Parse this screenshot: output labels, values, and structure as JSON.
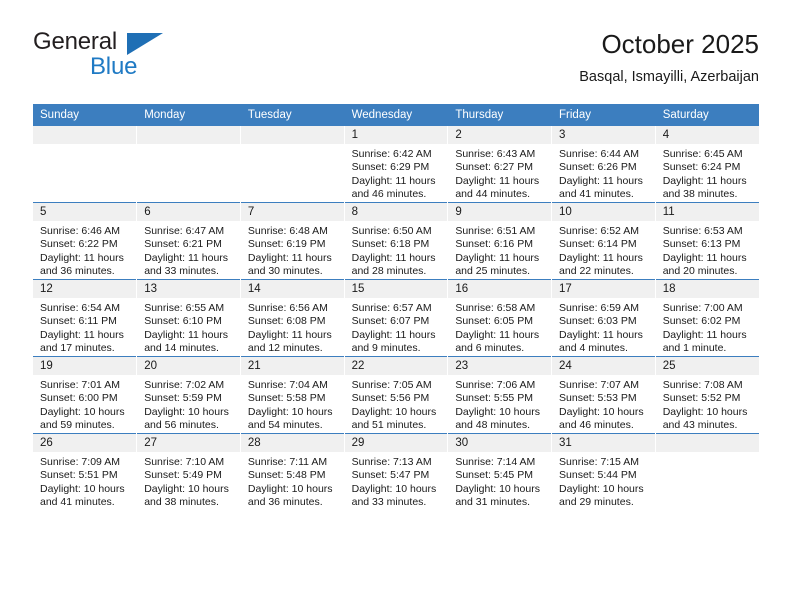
{
  "brand": {
    "name_top": "General",
    "name_bottom": "Blue",
    "triangle_color": "#1f6fb5",
    "blue_text_color": "#1f7ac4"
  },
  "header": {
    "title": "October 2025",
    "subtitle": "Basqal, Ismayilli, Azerbaijan"
  },
  "colors": {
    "header_row_background": "#3c7ebf",
    "header_row_text": "#ffffff",
    "daynumber_band": "#f0f0f0",
    "grid_line": "#3c7ebf",
    "body_text": "#1a1a1a"
  },
  "calendar": {
    "weekday_headers": [
      "Sunday",
      "Monday",
      "Tuesday",
      "Wednesday",
      "Thursday",
      "Friday",
      "Saturday"
    ],
    "weeks": [
      [
        {
          "day": "",
          "empty": true,
          "sunrise": "",
          "sunset": "",
          "daylight_line1": "",
          "daylight_line2": ""
        },
        {
          "day": "",
          "empty": true,
          "sunrise": "",
          "sunset": "",
          "daylight_line1": "",
          "daylight_line2": ""
        },
        {
          "day": "",
          "empty": true,
          "sunrise": "",
          "sunset": "",
          "daylight_line1": "",
          "daylight_line2": ""
        },
        {
          "day": "1",
          "empty": false,
          "sunrise": "Sunrise: 6:42 AM",
          "sunset": "Sunset: 6:29 PM",
          "daylight_line1": "Daylight: 11 hours",
          "daylight_line2": "and 46 minutes."
        },
        {
          "day": "2",
          "empty": false,
          "sunrise": "Sunrise: 6:43 AM",
          "sunset": "Sunset: 6:27 PM",
          "daylight_line1": "Daylight: 11 hours",
          "daylight_line2": "and 44 minutes."
        },
        {
          "day": "3",
          "empty": false,
          "sunrise": "Sunrise: 6:44 AM",
          "sunset": "Sunset: 6:26 PM",
          "daylight_line1": "Daylight: 11 hours",
          "daylight_line2": "and 41 minutes."
        },
        {
          "day": "4",
          "empty": false,
          "sunrise": "Sunrise: 6:45 AM",
          "sunset": "Sunset: 6:24 PM",
          "daylight_line1": "Daylight: 11 hours",
          "daylight_line2": "and 38 minutes."
        }
      ],
      [
        {
          "day": "5",
          "empty": false,
          "sunrise": "Sunrise: 6:46 AM",
          "sunset": "Sunset: 6:22 PM",
          "daylight_line1": "Daylight: 11 hours",
          "daylight_line2": "and 36 minutes."
        },
        {
          "day": "6",
          "empty": false,
          "sunrise": "Sunrise: 6:47 AM",
          "sunset": "Sunset: 6:21 PM",
          "daylight_line1": "Daylight: 11 hours",
          "daylight_line2": "and 33 minutes."
        },
        {
          "day": "7",
          "empty": false,
          "sunrise": "Sunrise: 6:48 AM",
          "sunset": "Sunset: 6:19 PM",
          "daylight_line1": "Daylight: 11 hours",
          "daylight_line2": "and 30 minutes."
        },
        {
          "day": "8",
          "empty": false,
          "sunrise": "Sunrise: 6:50 AM",
          "sunset": "Sunset: 6:18 PM",
          "daylight_line1": "Daylight: 11 hours",
          "daylight_line2": "and 28 minutes."
        },
        {
          "day": "9",
          "empty": false,
          "sunrise": "Sunrise: 6:51 AM",
          "sunset": "Sunset: 6:16 PM",
          "daylight_line1": "Daylight: 11 hours",
          "daylight_line2": "and 25 minutes."
        },
        {
          "day": "10",
          "empty": false,
          "sunrise": "Sunrise: 6:52 AM",
          "sunset": "Sunset: 6:14 PM",
          "daylight_line1": "Daylight: 11 hours",
          "daylight_line2": "and 22 minutes."
        },
        {
          "day": "11",
          "empty": false,
          "sunrise": "Sunrise: 6:53 AM",
          "sunset": "Sunset: 6:13 PM",
          "daylight_line1": "Daylight: 11 hours",
          "daylight_line2": "and 20 minutes."
        }
      ],
      [
        {
          "day": "12",
          "empty": false,
          "sunrise": "Sunrise: 6:54 AM",
          "sunset": "Sunset: 6:11 PM",
          "daylight_line1": "Daylight: 11 hours",
          "daylight_line2": "and 17 minutes."
        },
        {
          "day": "13",
          "empty": false,
          "sunrise": "Sunrise: 6:55 AM",
          "sunset": "Sunset: 6:10 PM",
          "daylight_line1": "Daylight: 11 hours",
          "daylight_line2": "and 14 minutes."
        },
        {
          "day": "14",
          "empty": false,
          "sunrise": "Sunrise: 6:56 AM",
          "sunset": "Sunset: 6:08 PM",
          "daylight_line1": "Daylight: 11 hours",
          "daylight_line2": "and 12 minutes."
        },
        {
          "day": "15",
          "empty": false,
          "sunrise": "Sunrise: 6:57 AM",
          "sunset": "Sunset: 6:07 PM",
          "daylight_line1": "Daylight: 11 hours",
          "daylight_line2": "and 9 minutes."
        },
        {
          "day": "16",
          "empty": false,
          "sunrise": "Sunrise: 6:58 AM",
          "sunset": "Sunset: 6:05 PM",
          "daylight_line1": "Daylight: 11 hours",
          "daylight_line2": "and 6 minutes."
        },
        {
          "day": "17",
          "empty": false,
          "sunrise": "Sunrise: 6:59 AM",
          "sunset": "Sunset: 6:03 PM",
          "daylight_line1": "Daylight: 11 hours",
          "daylight_line2": "and 4 minutes."
        },
        {
          "day": "18",
          "empty": false,
          "sunrise": "Sunrise: 7:00 AM",
          "sunset": "Sunset: 6:02 PM",
          "daylight_line1": "Daylight: 11 hours",
          "daylight_line2": "and 1 minute."
        }
      ],
      [
        {
          "day": "19",
          "empty": false,
          "sunrise": "Sunrise: 7:01 AM",
          "sunset": "Sunset: 6:00 PM",
          "daylight_line1": "Daylight: 10 hours",
          "daylight_line2": "and 59 minutes."
        },
        {
          "day": "20",
          "empty": false,
          "sunrise": "Sunrise: 7:02 AM",
          "sunset": "Sunset: 5:59 PM",
          "daylight_line1": "Daylight: 10 hours",
          "daylight_line2": "and 56 minutes."
        },
        {
          "day": "21",
          "empty": false,
          "sunrise": "Sunrise: 7:04 AM",
          "sunset": "Sunset: 5:58 PM",
          "daylight_line1": "Daylight: 10 hours",
          "daylight_line2": "and 54 minutes."
        },
        {
          "day": "22",
          "empty": false,
          "sunrise": "Sunrise: 7:05 AM",
          "sunset": "Sunset: 5:56 PM",
          "daylight_line1": "Daylight: 10 hours",
          "daylight_line2": "and 51 minutes."
        },
        {
          "day": "23",
          "empty": false,
          "sunrise": "Sunrise: 7:06 AM",
          "sunset": "Sunset: 5:55 PM",
          "daylight_line1": "Daylight: 10 hours",
          "daylight_line2": "and 48 minutes."
        },
        {
          "day": "24",
          "empty": false,
          "sunrise": "Sunrise: 7:07 AM",
          "sunset": "Sunset: 5:53 PM",
          "daylight_line1": "Daylight: 10 hours",
          "daylight_line2": "and 46 minutes."
        },
        {
          "day": "25",
          "empty": false,
          "sunrise": "Sunrise: 7:08 AM",
          "sunset": "Sunset: 5:52 PM",
          "daylight_line1": "Daylight: 10 hours",
          "daylight_line2": "and 43 minutes."
        }
      ],
      [
        {
          "day": "26",
          "empty": false,
          "sunrise": "Sunrise: 7:09 AM",
          "sunset": "Sunset: 5:51 PM",
          "daylight_line1": "Daylight: 10 hours",
          "daylight_line2": "and 41 minutes."
        },
        {
          "day": "27",
          "empty": false,
          "sunrise": "Sunrise: 7:10 AM",
          "sunset": "Sunset: 5:49 PM",
          "daylight_line1": "Daylight: 10 hours",
          "daylight_line2": "and 38 minutes."
        },
        {
          "day": "28",
          "empty": false,
          "sunrise": "Sunrise: 7:11 AM",
          "sunset": "Sunset: 5:48 PM",
          "daylight_line1": "Daylight: 10 hours",
          "daylight_line2": "and 36 minutes."
        },
        {
          "day": "29",
          "empty": false,
          "sunrise": "Sunrise: 7:13 AM",
          "sunset": "Sunset: 5:47 PM",
          "daylight_line1": "Daylight: 10 hours",
          "daylight_line2": "and 33 minutes."
        },
        {
          "day": "30",
          "empty": false,
          "sunrise": "Sunrise: 7:14 AM",
          "sunset": "Sunset: 5:45 PM",
          "daylight_line1": "Daylight: 10 hours",
          "daylight_line2": "and 31 minutes."
        },
        {
          "day": "31",
          "empty": false,
          "sunrise": "Sunrise: 7:15 AM",
          "sunset": "Sunset: 5:44 PM",
          "daylight_line1": "Daylight: 10 hours",
          "daylight_line2": "and 29 minutes."
        },
        {
          "day": "",
          "empty": true,
          "sunrise": "",
          "sunset": "",
          "daylight_line1": "",
          "daylight_line2": ""
        }
      ]
    ]
  }
}
